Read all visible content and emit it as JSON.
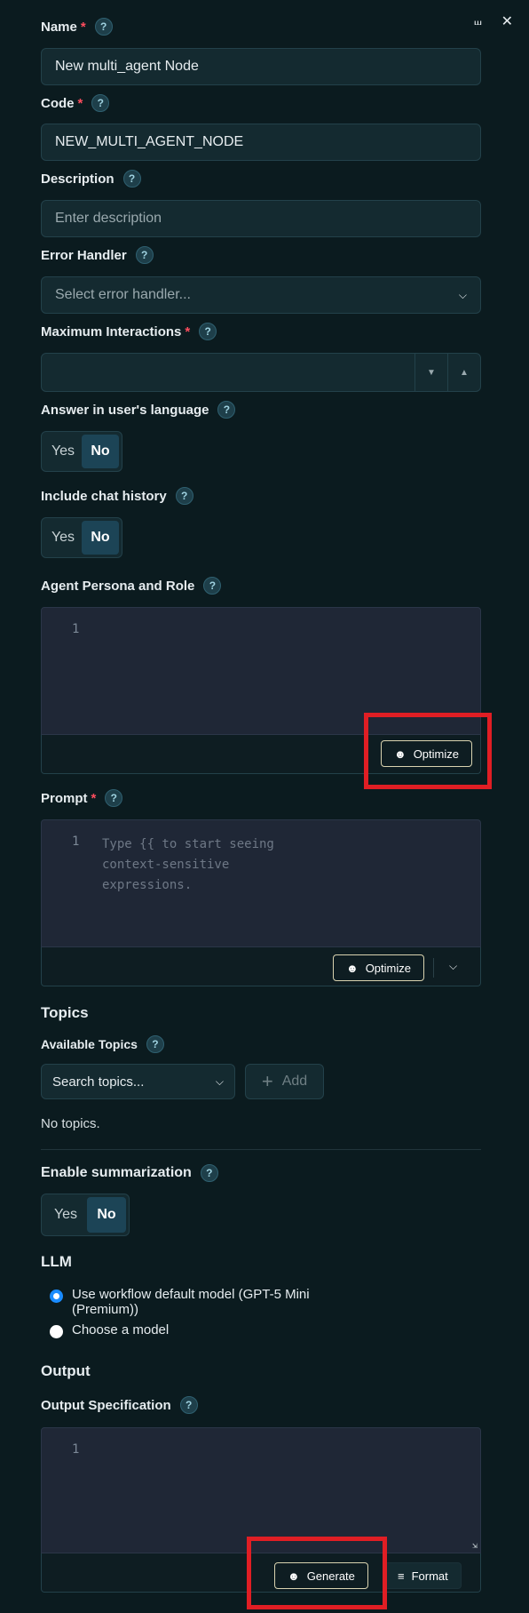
{
  "header": {
    "pin_icon": "unpin-icon",
    "close_icon": "close-icon"
  },
  "fields": {
    "name": {
      "label": "Name",
      "required": "*",
      "value": "New multi_agent Node"
    },
    "code": {
      "label": "Code",
      "required": "*",
      "value": "NEW_MULTI_AGENT_NODE"
    },
    "description": {
      "label": "Description",
      "placeholder": "Enter description"
    },
    "error_handler": {
      "label": "Error Handler",
      "placeholder": "Select error handler..."
    },
    "max_interactions": {
      "label": "Maximum Interactions",
      "required": "*",
      "value": ""
    },
    "answer_lang": {
      "label": "Answer in user's language",
      "yes": "Yes",
      "no": "No",
      "selected": "No"
    },
    "chat_history": {
      "label": "Include chat history",
      "yes": "Yes",
      "no": "No",
      "selected": "No"
    },
    "persona": {
      "label": "Agent Persona and Role",
      "line": "1",
      "optimize": "Optimize"
    },
    "prompt": {
      "label": "Prompt",
      "required": "*",
      "line": "1",
      "placeholder_lines": [
        "Type {{ to start seeing",
        "context-sensitive",
        "expressions."
      ],
      "optimize": "Optimize"
    }
  },
  "topics": {
    "title": "Topics",
    "available_label": "Available Topics",
    "search_placeholder": "Search topics...",
    "add_label": "Add",
    "empty": "No topics."
  },
  "summarization": {
    "label": "Enable summarization",
    "yes": "Yes",
    "no": "No",
    "selected": "No"
  },
  "llm": {
    "title": "LLM",
    "option1_line1": "Use workflow default model (GPT-5 Mini",
    "option1_line2": "(Premium))",
    "option2": "Choose a model",
    "selected": "option1"
  },
  "output": {
    "title": "Output",
    "spec_label": "Output Specification",
    "line": "1",
    "generate": "Generate",
    "format": "Format"
  },
  "help_glyph": "?",
  "colors": {
    "accent_red": "#e01e24",
    "toggle_on": "#1c4456",
    "radio_selected": "#1a8cff"
  }
}
